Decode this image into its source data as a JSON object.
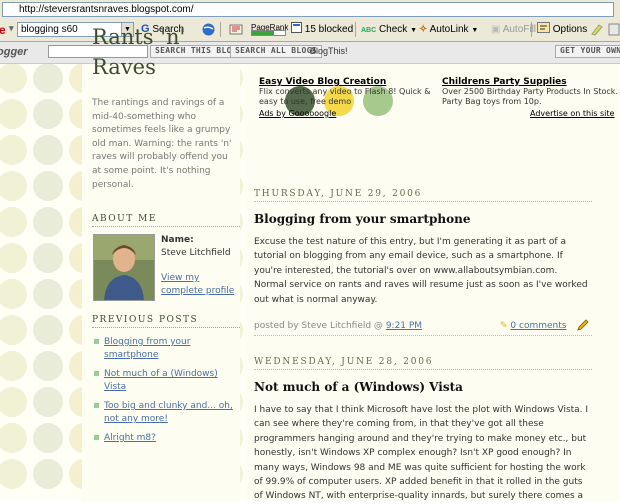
{
  "browser": {
    "address": "http://steversrantsnraves.blogspot.com/",
    "toolbar": {
      "search_value": "blogging s60",
      "search_label": "Search",
      "pagerank_label": "PageRank",
      "blocked_label": "15 blocked",
      "check_label": "Check",
      "autolink_label": "AutoLink",
      "autofill_label": "AutoFill",
      "options_label": "Options"
    }
  },
  "blogger_bar": {
    "logo": "ogger",
    "search_blog": "SEARCH THIS BLOG",
    "search_all": "SEARCH ALL BLOGS",
    "blogthis": "BlogThis!",
    "get_own": "GET YOUR OWN B"
  },
  "blog": {
    "title": "Rants 'n' Raves",
    "description": "The rantings and ravings of a mid-40-something who sometimes feels like a grumpy old man. Warning: the rants 'n' raves will probably offend you at some point. It's nothing personal.",
    "colors": {
      "dot_dark": "#556b4c",
      "dot_yellow": "#f4d94a",
      "dot_light": "#a6c98c",
      "title": "#3d4c2c"
    }
  },
  "about": {
    "heading": "ABOUT ME",
    "name_label": "Name:",
    "name": "Steve Litchfield",
    "profile_link": "View my complete profile"
  },
  "previous_posts": {
    "heading": "PREVIOUS POSTS",
    "items": [
      "Blogging from your smartphone",
      "Not much of a (Windows) Vista",
      "Too big and clunky and... oh, not any more!",
      "Alright m8?"
    ]
  },
  "ads": {
    "items": [
      {
        "title": "Easy Video Blog Creation",
        "text": "Flix converts any video to Flash 8! Quick & easy to use, free demo"
      },
      {
        "title": "Childrens Party Supplies",
        "text": "Over 2500 Birthday Party Products In Stock. Party Bag toys from 10p."
      }
    ],
    "ads_by": "Ads by Goooooogle",
    "advertise": "Advertise on this site"
  },
  "posts": [
    {
      "date": "THURSDAY, JUNE 29, 2006",
      "title": "Blogging from your smartphone",
      "body": "Excuse the test nature of this entry, but I'm generating it as part of a tutorial on blogging from any email device, such as a smartphone. If you're interested, the tutorial's over on www.allaboutsymbian.com. Normal service on rants and raves will resume just as soon as I've worked out what is normal anyway.",
      "posted_by": "posted by Steve Litchfield @",
      "time": "9:21 PM",
      "comments": "0 comments"
    },
    {
      "date": "WEDNESDAY, JUNE 28, 2006",
      "title": "Not much of a (Windows) Vista",
      "body": "I have to say that I think Microsoft have lost the plot with Windows Vista. I can see where they're coming from, in that they've got all these programmers hanging around and they're trying to make money etc., but honestly, isn't Windows XP complex enough? Isn't XP good enough? In many ways, Windows 98 and ME was quite sufficient for hosting the work of 99.9% of computer users. XP added benefit in that it rolled in the guts of Windows NT, with enterprise-quality innards, but surely there comes a"
    }
  ]
}
